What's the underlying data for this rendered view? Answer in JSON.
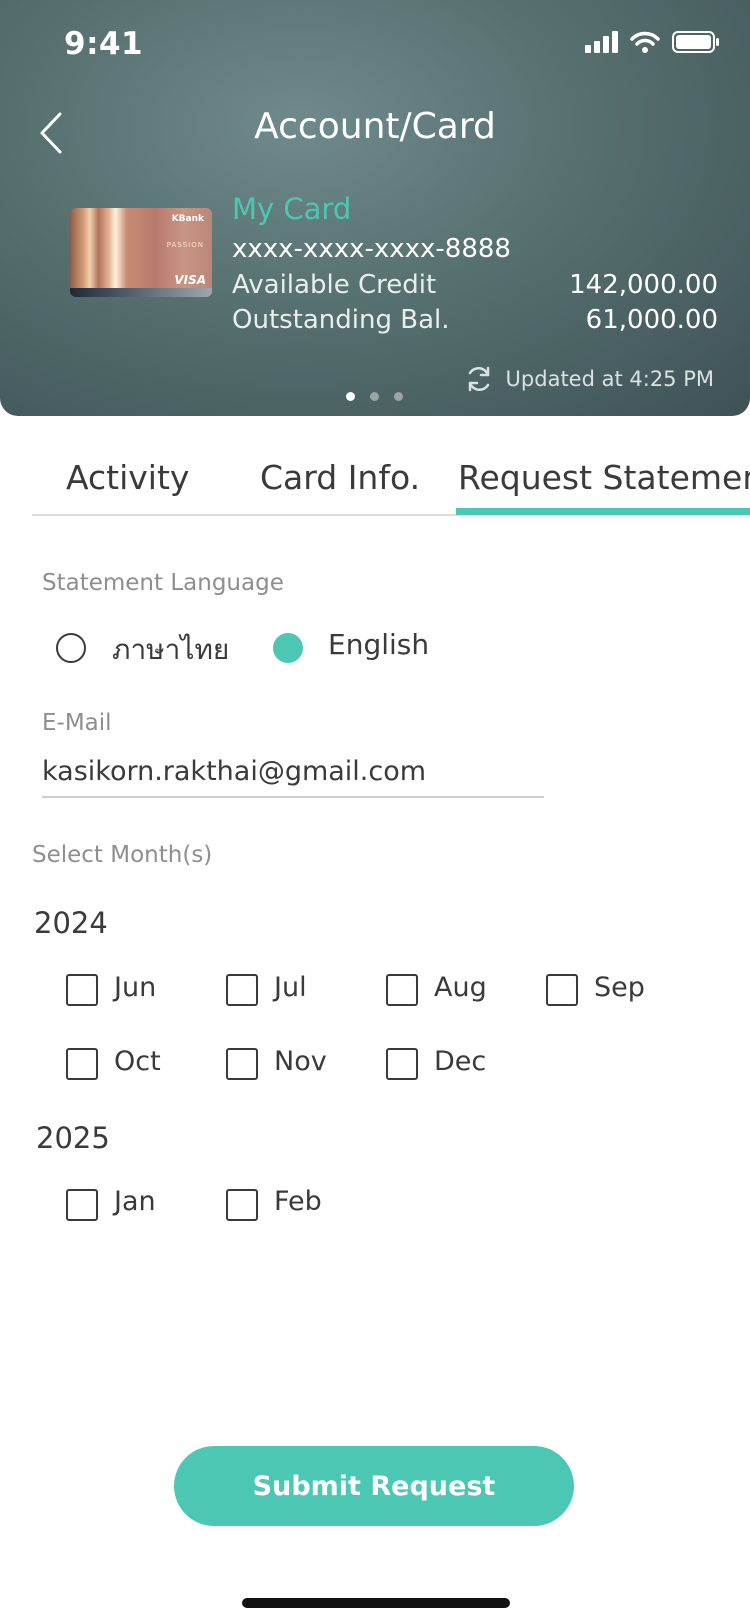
{
  "status_bar": {
    "time": "9:41"
  },
  "header": {
    "title": "Account/Card"
  },
  "card": {
    "name": "My Card",
    "number": "xxxx-xxxx-xxxx-8888",
    "bank_logo": "KBank",
    "card_text": "PASSION",
    "network": "VISA",
    "available_credit_label": "Available Credit",
    "available_credit_value": "142,000.00",
    "outstanding_label": "Outstanding Bal.",
    "outstanding_value": "61,000.00",
    "updated_text": "Updated at 4:25 PM"
  },
  "tabs": [
    {
      "label": "Activity",
      "active": false
    },
    {
      "label": "Card Info.",
      "active": false
    },
    {
      "label": "Request Statement",
      "active": true
    }
  ],
  "statement_language": {
    "label": "Statement Language",
    "options": [
      {
        "label": "ภาษาไทย",
        "selected": false
      },
      {
        "label": "English",
        "selected": true
      }
    ]
  },
  "email": {
    "label": "E-Mail",
    "value": "kasikorn.rakthai@gmail.com"
  },
  "months": {
    "label": "Select Month(s)",
    "years": [
      {
        "year": "2024",
        "months": [
          "Jun",
          "Jul",
          "Aug",
          "Sep",
          "Oct",
          "Nov",
          "Dec"
        ]
      },
      {
        "year": "2025",
        "months": [
          "Jan",
          "Feb"
        ]
      }
    ]
  },
  "submit_label": "Submit Request",
  "colors": {
    "accent": "#4cc7b3",
    "header_bg": "#56706f"
  },
  "icons": [
    "back-arrow-icon",
    "signal-icon",
    "wifi-icon",
    "battery-icon",
    "refresh-icon"
  ]
}
